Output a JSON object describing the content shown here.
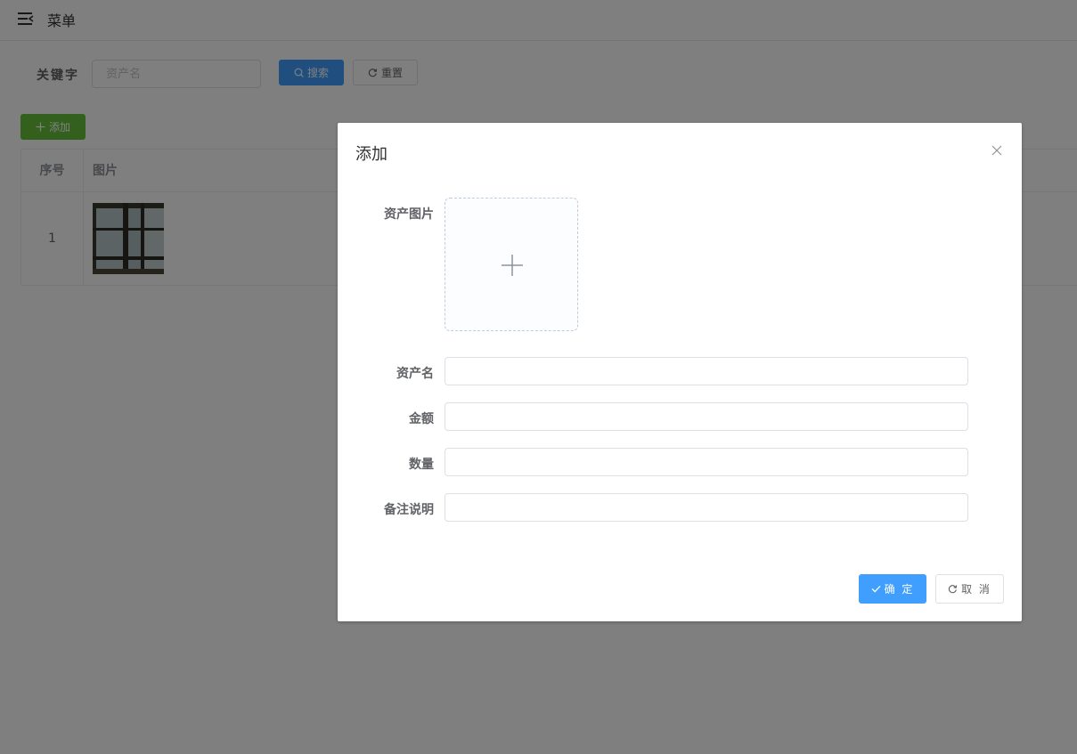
{
  "header": {
    "title": "菜单",
    "menu_icon": "menu-fold-icon"
  },
  "search": {
    "label": "关键字",
    "placeholder": "资产名",
    "value": "",
    "search_label": "搜索",
    "reset_label": "重置"
  },
  "toolbar": {
    "add_label": "添加"
  },
  "table": {
    "columns": [
      "序号",
      "图片"
    ],
    "rows": [
      {
        "index": "1",
        "image": "window-photo"
      }
    ]
  },
  "dialog": {
    "title": "添加",
    "fields": {
      "image_label": "资产图片",
      "name_label": "资产名",
      "amount_label": "金额",
      "quantity_label": "数量",
      "remark_label": "备注说明"
    },
    "confirm_label": "确 定",
    "cancel_label": "取 消"
  },
  "colors": {
    "primary": "#409eff",
    "success": "#67c23a",
    "mask": "rgba(0,0,0,0.5)"
  }
}
